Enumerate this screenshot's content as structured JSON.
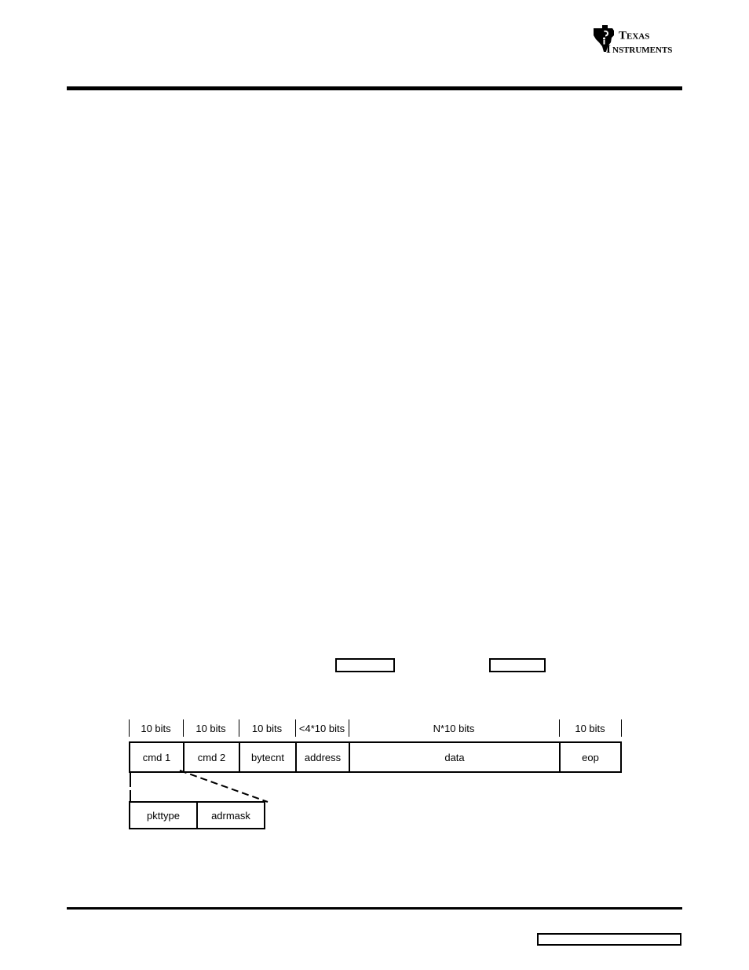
{
  "document": {
    "brand": {
      "name": "Texas Instruments",
      "line1": "Texas",
      "line2": "Instruments",
      "logo_icon": "texas-instruments-logo-icon"
    }
  },
  "diagram": {
    "name": "packet-format-diagram",
    "bit_widths": [
      "10 bits",
      "10 bits",
      "10 bits",
      "<4*10 bits",
      "N*10 bits",
      "10 bits"
    ],
    "fields": [
      "cmd 1",
      "cmd 2",
      "bytecnt",
      "address",
      "data",
      "eop"
    ],
    "expansion_fields": [
      "pkttype",
      "adrmask"
    ]
  },
  "placeholders": {
    "caption_box_1": "",
    "caption_box_2": "",
    "footer_box": ""
  },
  "colors": {
    "ink": "#000000",
    "page": "#ffffff"
  }
}
